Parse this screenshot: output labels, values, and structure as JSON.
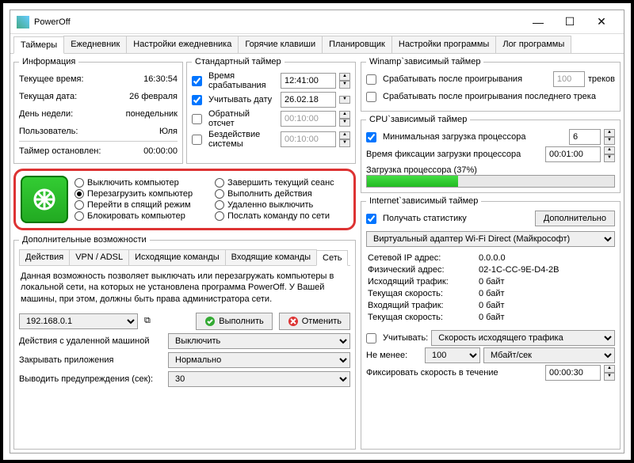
{
  "window": {
    "title": "PowerOff"
  },
  "mainTabs": [
    "Таймеры",
    "Ежедневник",
    "Настройки ежедневника",
    "Горячие клавиши",
    "Планировщик",
    "Настройки программы",
    "Лог программы"
  ],
  "info": {
    "legend": "Информация",
    "timeLabel": "Текущее время:",
    "timeVal": "16:30:54",
    "dateLabel": "Текущая дата:",
    "dateVal": "26 февраля",
    "dowLabel": "День недели:",
    "dowVal": "понедельник",
    "userLabel": "Пользователь:",
    "userVal": "Юля",
    "stoppedLabel": "Таймер остановлен:",
    "stoppedVal": "00:00:00"
  },
  "std": {
    "legend": "Стандартный таймер",
    "triggerLabel": "Время срабатывания",
    "triggerVal": "12:41:00",
    "dateLabel": "Учитывать дату",
    "dateVal": "26.02.18",
    "countdownLabel": "Обратный отсчет",
    "countdownVal": "00:10:00",
    "idleLabel": "Бездействие системы",
    "idleVal": "00:10:00"
  },
  "actions": {
    "r1": "Выключить компьютер",
    "r2": "Завершить текущий сеанс",
    "r3": "Перезагрузить компьютер",
    "r4": "Выполнить действия",
    "r5": "Перейти в спящий режим",
    "r6": "Удаленно выключить",
    "r7": "Блокировать компьютер",
    "r8": "Послать команду по сети"
  },
  "extra": {
    "legend": "Дополнительные возможности",
    "subtabs": [
      "Действия",
      "VPN / ADSL",
      "Исходящие команды",
      "Входящие команды",
      "Сеть"
    ],
    "desc": "Данная возможность позволяет выключать или перезагружать компьютеры в локальной сети, на которых не установлена программа PowerOff. У Вашей машины, при этом, должны быть права администратора сети.",
    "ip": "192.168.0.1",
    "execBtn": "Выполнить",
    "cancelBtn": "Отменить",
    "remoteLabel": "Действия с удаленной машиной",
    "remoteVal": "Выключить",
    "closeAppsLabel": "Закрывать приложения",
    "closeAppsVal": "Нормально",
    "warnLabel": "Выводить предупреждения (сек):",
    "warnVal": "30"
  },
  "winamp": {
    "legend": "Winamp`зависимый таймер",
    "afterLabel": "Срабатывать после проигрывания",
    "afterVal": "100",
    "tracksLabel": "треков",
    "lastLabel": "Срабатывать после проигрывания последнего трека"
  },
  "cpu": {
    "legend": "CPU`зависимый таймер",
    "minLabel": "Минимальная загрузка процессора",
    "minVal": "6",
    "fixLabel": "Время фиксации загрузки процессора",
    "fixVal": "00:01:00",
    "loadLabel": "Загрузка процессора (37%)",
    "loadPct": 37
  },
  "net": {
    "legend": "Internet`зависимый таймер",
    "statsLabel": "Получать статистику",
    "advBtn": "Дополнительно",
    "adapter": "Виртуальный адаптер Wi-Fi Direct (Майкрософт)",
    "ipLabel": "Сетевой IP адрес:",
    "ipVal": "0.0.0.0",
    "macLabel": "Физический адрес:",
    "macVal": "02-1C-CC-9E-D4-2B",
    "outLabel": "Исходящий трафик:",
    "outVal": "0 байт",
    "outSpeedLabel": "Текущая скорость:",
    "outSpeedVal": "0 байт",
    "inLabel": "Входящий трафик:",
    "inVal": "0 байт",
    "inSpeedLabel": "Текущая скорость:",
    "inSpeedVal": "0 байт",
    "considerLabel": "Учитывать:",
    "considerVal": "Скорость исходящего трафика",
    "minLabel": "Не менее:",
    "minVal": "100",
    "unitVal": "Мбайт/сек",
    "fixLabel": "Фиксировать скорость в течение",
    "fixVal": "00:00:30"
  }
}
